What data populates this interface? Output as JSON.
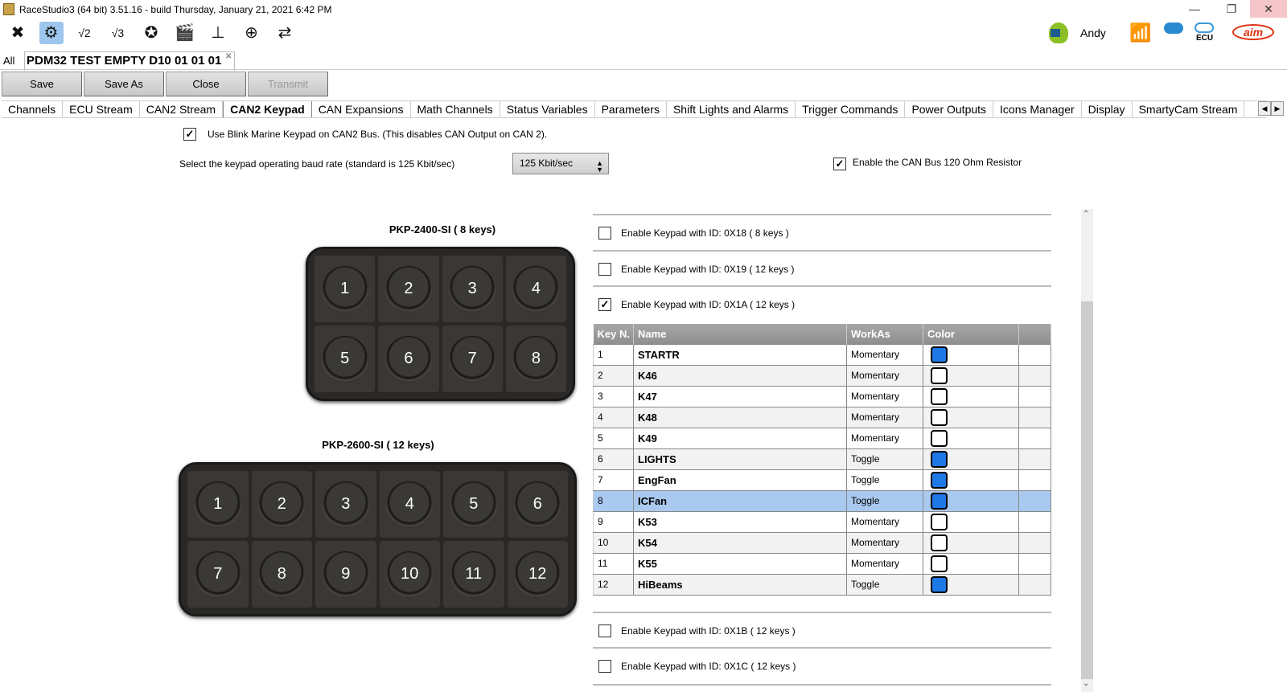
{
  "window": {
    "title": "RaceStudio3 (64 bit) 3.51.16 - build Thursday, January 21, 2021 6:42 PM",
    "minimize": "—",
    "restore": "❐",
    "close": "✕"
  },
  "toolbar": {
    "icons": [
      "wrench-icon",
      "gear-icon",
      "v2-icon",
      "v3-icon",
      "map-icon",
      "clapper-icon",
      "water-temp-icon",
      "add-device-icon",
      "transfer-icon"
    ],
    "user": "Andy",
    "ecu_label": "ECU"
  },
  "doc_tabs": {
    "all": "All",
    "active": "PDM32 TEST EMPTY  D10 01 01 01",
    "close": "✕"
  },
  "buttons": {
    "save": "Save",
    "save_as": "Save As",
    "close": "Close",
    "transmit": "Transmit"
  },
  "tabs": [
    "Channels",
    "ECU Stream",
    "CAN2 Stream",
    "CAN2 Keypad",
    "CAN Expansions",
    "Math Channels",
    "Status Variables",
    "Parameters",
    "Shift Lights and Alarms",
    "Trigger Commands",
    "Power Outputs",
    "Icons Manager",
    "Display",
    "SmartyCam Stream"
  ],
  "active_tab": "CAN2 Keypad",
  "options": {
    "use_blink": "Use Blink Marine Keypad on CAN2 Bus. (This disables CAN Output on CAN 2).",
    "use_blink_checked": true,
    "baud_label": "Select the keypad operating baud rate (standard is 125 Kbit/sec)",
    "baud_value": "125 Kbit/sec",
    "resistor": "Enable the CAN Bus 120 Ohm Resistor",
    "resistor_checked": true
  },
  "keypad8": {
    "title": "PKP-2400-SI  ( 8 keys)",
    "keys": [
      "1",
      "2",
      "3",
      "4",
      "5",
      "6",
      "7",
      "8"
    ]
  },
  "keypad12": {
    "title": "PKP-2600-SI  ( 12 keys)",
    "keys": [
      "1",
      "2",
      "3",
      "4",
      "5",
      "6",
      "7",
      "8",
      "9",
      "10",
      "11",
      "12"
    ]
  },
  "keypad_options": [
    {
      "label": "Enable Keypad with ID:  0X18   ( 8 keys )",
      "checked": false
    },
    {
      "label": "Enable Keypad with ID:  0X19   ( 12 keys )",
      "checked": false
    },
    {
      "label": "Enable Keypad with ID:  0X1A   ( 12 keys )",
      "checked": true
    },
    {
      "label": "Enable Keypad with ID:  0X1B   ( 12 keys )",
      "checked": false
    },
    {
      "label": "Enable Keypad with ID:  0X1C   ( 12 keys )",
      "checked": false
    }
  ],
  "table": {
    "headers": [
      "Key N.",
      "Name",
      "WorkAs",
      "Color",
      ""
    ],
    "rows": [
      {
        "key": "1",
        "name": "STARTR",
        "work": "Momentary",
        "color": "#1e78e6"
      },
      {
        "key": "2",
        "name": "K46",
        "work": "Momentary",
        "color": "#ffffff"
      },
      {
        "key": "3",
        "name": "K47",
        "work": "Momentary",
        "color": "#ffffff"
      },
      {
        "key": "4",
        "name": "K48",
        "work": "Momentary",
        "color": "#ffffff"
      },
      {
        "key": "5",
        "name": "K49",
        "work": "Momentary",
        "color": "#ffffff"
      },
      {
        "key": "6",
        "name": "LIGHTS",
        "work": "Toggle",
        "color": "#1e78e6"
      },
      {
        "key": "7",
        "name": "EngFan",
        "work": "Toggle",
        "color": "#1e78e6"
      },
      {
        "key": "8",
        "name": "ICFan",
        "work": "Toggle",
        "color": "#1e78e6"
      },
      {
        "key": "9",
        "name": "K53",
        "work": "Momentary",
        "color": "#ffffff"
      },
      {
        "key": "10",
        "name": "K54",
        "work": "Momentary",
        "color": "#ffffff"
      },
      {
        "key": "11",
        "name": "K55",
        "work": "Momentary",
        "color": "#ffffff"
      },
      {
        "key": "12",
        "name": "HiBeams",
        "work": "Toggle",
        "color": "#1e78e6"
      }
    ],
    "selected": "8"
  }
}
